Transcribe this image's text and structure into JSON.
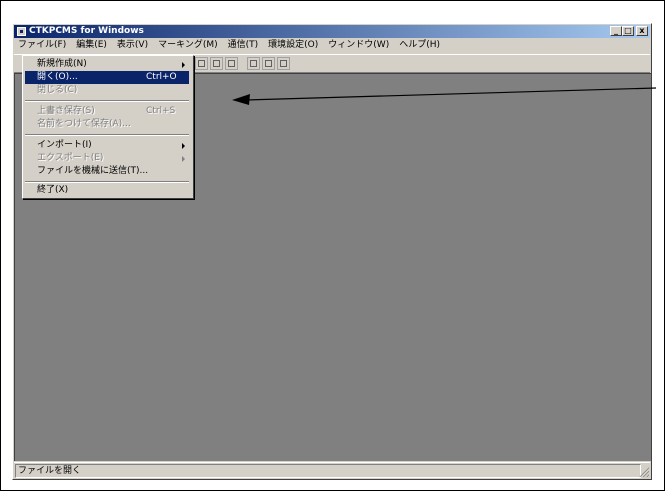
{
  "window": {
    "title": "CTKPCMS for Windows"
  },
  "title_buttons": {
    "minimize": "_",
    "maximize": "□",
    "close": "x"
  },
  "menubar": [
    {
      "label": "ファイル(F)"
    },
    {
      "label": "編集(E)"
    },
    {
      "label": "表示(V)"
    },
    {
      "label": "マーキング(M)"
    },
    {
      "label": "通信(T)"
    },
    {
      "label": "環境設定(O)"
    },
    {
      "label": "ウィンドウ(W)"
    },
    {
      "label": "ヘルプ(H)"
    }
  ],
  "file_menu": {
    "new": "新規作成(N)",
    "open": "開く(O)...",
    "open_shortcut": "Ctrl+O",
    "close": "閉じる(C)",
    "save": "上書き保存(S)",
    "save_shortcut": "Ctrl+S",
    "save_as": "名前をつけて保存(A)...",
    "import": "インポート(I)",
    "export": "エクスポート(E)",
    "send": "ファイルを機械に送信(T)...",
    "exit": "終了(X)"
  },
  "statusbar": {
    "text": "ファイルを開く"
  },
  "colors": {
    "titlebar": "#0a246a",
    "client": "#808080",
    "selection": "#0a246a"
  }
}
